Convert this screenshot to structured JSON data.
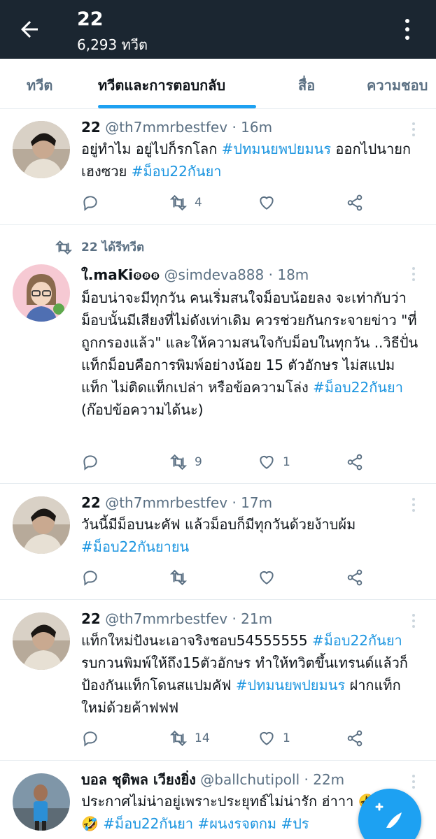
{
  "header": {
    "title": "22",
    "subtitle": "6,293 ทวีต"
  },
  "tabs": [
    {
      "label": "ทวีต"
    },
    {
      "label": "ทวีตและการตอบกลับ"
    },
    {
      "label": "สื่อ"
    },
    {
      "label": "ความชอบ"
    }
  ],
  "tweets": [
    {
      "name": "22",
      "handle": "@th7mmrbestfev",
      "time": "· 16m",
      "t1": "อยู่ทำไม อยู่ไปก็รกโลก ",
      "h1": "#ปทมนยพปยมนร",
      "t2": " ออกไปนายกเฮงซวย ",
      "h2": "#ม็อบ22กันยา",
      "retweets": "4",
      "likes": ""
    },
    {
      "retweeted_by": "22 ได้รีทวีต",
      "name": "ใ",
      "handle": "@simdeva888",
      "time": "· 18m",
      "t1": "ม็อบน่าจะมีทุกวัน คนเริ่มสนใจม็อบน้อยลง จะเท่ากับว่าม็อบนั้นมีเสียงที่ไม่ดังเท่าเดิม ควรช่วยกันกระจายข่าว \"ที่ถูกกรองแล้ว\" และให้ความสนใจกับม็อบในทุกวัน ..วิธีปั่นแท็กม็อบคือการพิมพ์อย่างน้อย 15 ตัวอักษร ไม่สแปมแท็ก ไม่ติดแท็กเปล่า หรือข้อความโล่ง ",
      "h1": "#ม็อบ22กันยา",
      "t2": " (ก๊อปข้อความได้นะ)",
      "retweets": "9",
      "likes": "1"
    },
    {
      "name": "22",
      "handle": "@th7mmrbestfev",
      "time": "· 17m",
      "t1": "วันนี้มีม็อบนะคัฟ แล้วม็อบก็มีทุกวันด้วยง้าบผ้ม ",
      "h1": "#ม็อบ22กันยายน",
      "retweets": "",
      "likes": ""
    },
    {
      "name": "22",
      "handle": "@th7mmrbestfev",
      "time": "· 21m",
      "t1": "แท็กใหม่ปังนะเอาจริงชอบ54555555 ",
      "h1": "#ม็อบ22กันยา",
      "t2": " รบกวนพิมพ์ให้ถึง15ตัวอักษร ทำให้ทวิตขึ้นเทรนด์แล้วก็ป้องกันแท็กโดนสแปมคัฟ ",
      "h2": "#ปทมนยพปยมนร",
      "t3": " ฝากแท็กใหม่ด้วยค้าฟฟฟ",
      "retweets": "14",
      "likes": "1"
    },
    {
      "name": "บอล ชุติพล เวียงยิ่ง",
      "handle": "@ballchutipoll",
      "time": "· 22m",
      "t1": "ประกาศไม่น่าอยู่เพราะประยุทธ์ไม่น่ารัก ฮ่าาา 🤣🤣🤣 ",
      "h1": "#ม็อบ22กันยา",
      "t2": " ",
      "h2": "#ผนงรจตกม",
      "t3": " ",
      "h3": "#ปร"
    }
  ],
  "colors": {
    "header_bg": "#1b2631",
    "accent": "#1da1f2",
    "hashtag": "#1b95e0",
    "muted": "#5b7083"
  }
}
